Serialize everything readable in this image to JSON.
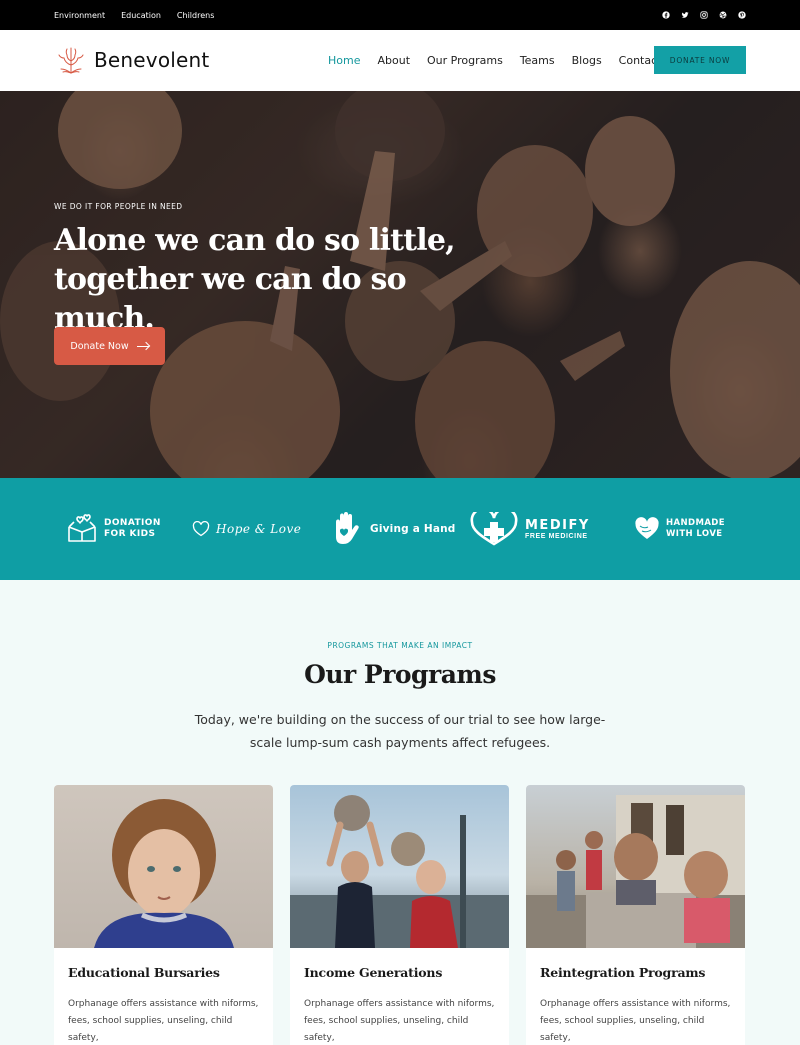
{
  "topbar": {
    "links": [
      "Environment",
      "Education",
      "Childrens"
    ],
    "social_icons": [
      "facebook-icon",
      "twitter-icon",
      "instagram-icon",
      "dribbble-icon",
      "pinterest-icon"
    ]
  },
  "header": {
    "logo_text": "Benevolent",
    "nav": [
      "Home",
      "About",
      "Our Programs",
      "Teams",
      "Blogs",
      "Contact"
    ],
    "active_nav": "Home",
    "donate_label": "DONATE NOW"
  },
  "hero": {
    "kicker": "WE DO IT FOR PEOPLE IN NEED",
    "title_line1": "Alone we can do so little,",
    "title_line2": "together we can do so much.",
    "button_label": "Donate Now"
  },
  "partners": {
    "donation_line1": "DONATION",
    "donation_line2": "FOR KIDS",
    "hope_love": "Hope & Love",
    "giving_hand": "Giving a Hand",
    "medify": "MEDIFY",
    "medify_sub": "FREE MEDICINE",
    "handmade_line1": "HANDMADE",
    "handmade_line2": "WITH LOVE"
  },
  "programs": {
    "kicker": "PROGRAMS THAT MAKE AN IMPACT",
    "title": "Our Programs",
    "description": "Today, we're building on the success of our trial to see how large-scale lump-sum cash payments affect refugees.",
    "cards": [
      {
        "title": "Educational Bursaries",
        "text": "Orphanage offers assistance with niforms, fees, school supplies, unseling, child safety,"
      },
      {
        "title": "Income Generations",
        "text": "Orphanage offers assistance with niforms, fees, school supplies, unseling, child safety,"
      },
      {
        "title": "Reintegration Programs",
        "text": "Orphanage offers assistance with niforms, fees, school supplies, unseling, child safety,"
      }
    ]
  },
  "colors": {
    "accent": "#13a0a6",
    "hero_button": "#d75a45",
    "topbar": "#000000",
    "section_bg": "#f2faf9"
  }
}
